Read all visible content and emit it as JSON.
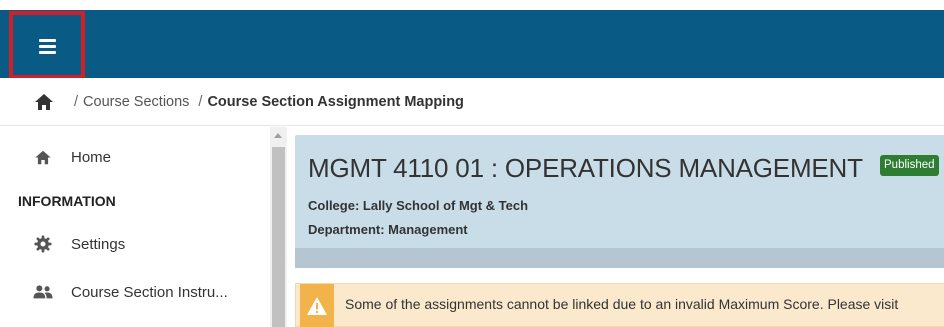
{
  "header": {
    "menu_icon": "hamburger-menu-icon",
    "bar_color": "#0a5a86",
    "highlight_color": "#d21f27"
  },
  "breadcrumb": {
    "home_icon": "home-icon",
    "items": [
      "Course Sections",
      "Course Section Assignment Mapping"
    ]
  },
  "sidebar": {
    "home": {
      "label": "Home",
      "icon": "home-icon"
    },
    "section_heading": "INFORMATION",
    "settings": {
      "label": "Settings",
      "icon": "gear-icon"
    },
    "instructors": {
      "label": "Course Section Instru...",
      "icon": "people-icon"
    }
  },
  "course": {
    "title": "MGMT 4110 01 : OPERATIONS MANAGEMENT",
    "status_badge": "Published",
    "college": "College: Lally School of Mgt & Tech",
    "department": "Department: Management"
  },
  "alert": {
    "icon": "warning-icon",
    "message": "Some of the assignments cannot be linked due to an invalid Maximum Score. Please visit"
  }
}
